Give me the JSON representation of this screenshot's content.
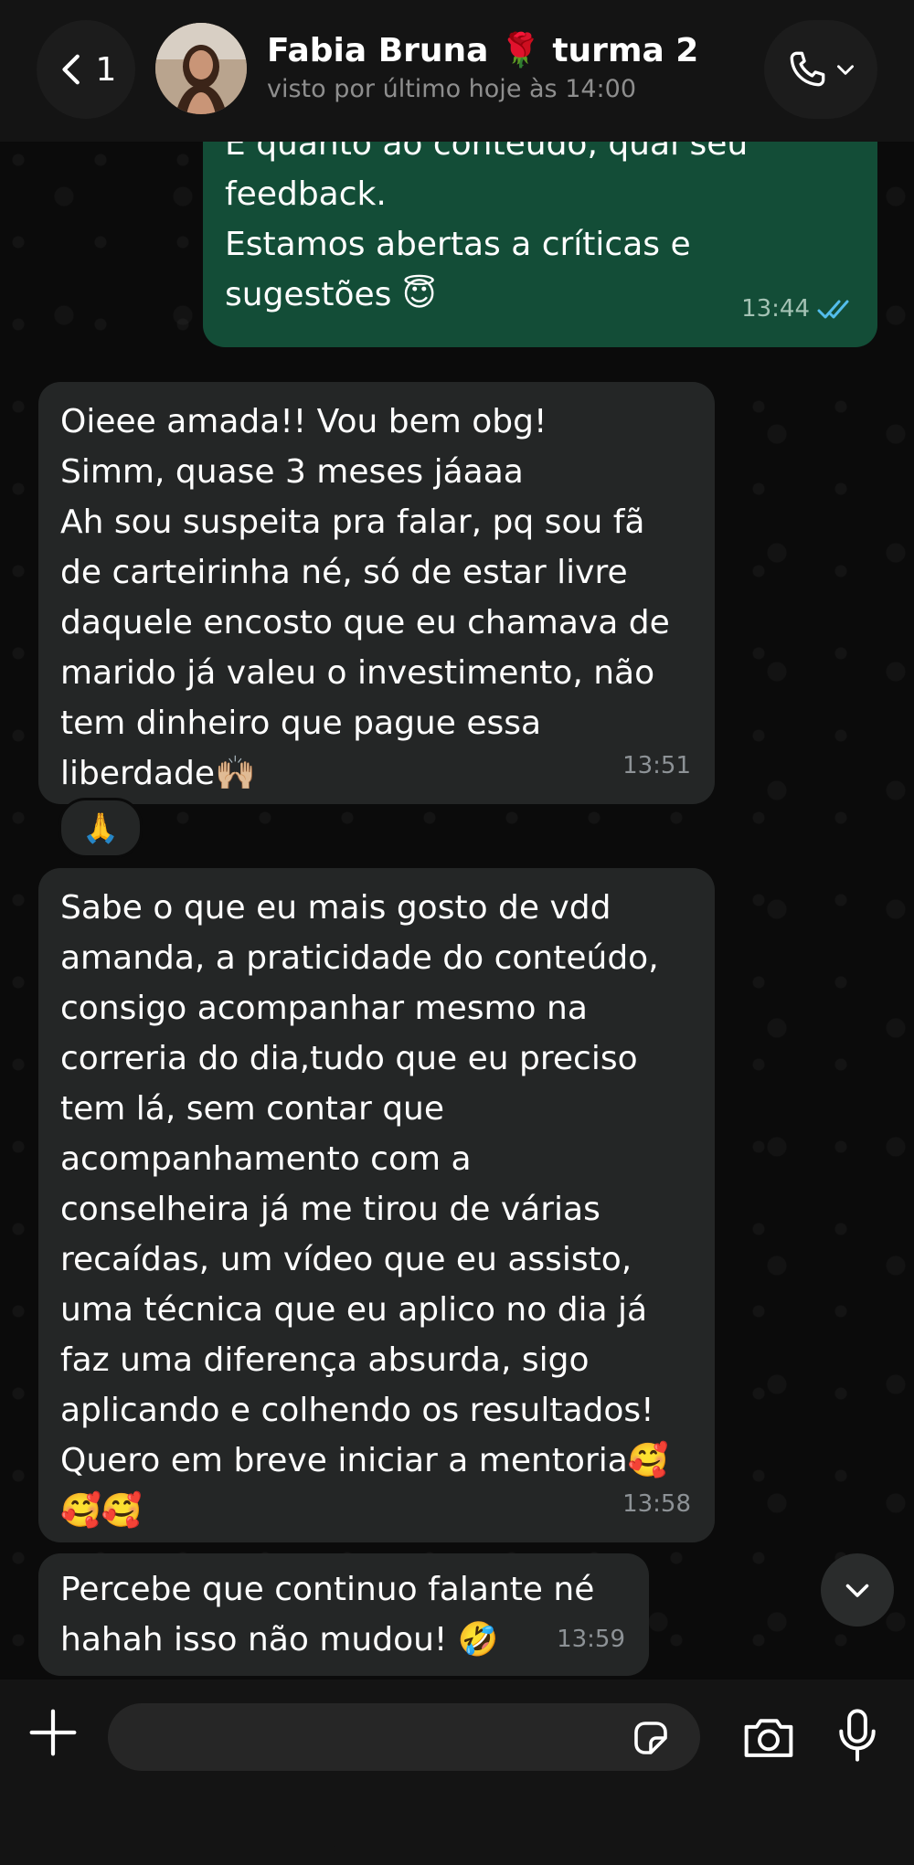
{
  "header": {
    "back_count": "1",
    "contact_name": "Fabia Bruna 🌹 turma 2",
    "contact_status": "visto por último hoje às 14:00"
  },
  "messages": [
    {
      "direction": "outgoing",
      "lines": [
        "E quanto ao conteúdo, qual seu",
        "feedback.",
        "Estamos abertas a críticas e",
        "sugestões 😇"
      ],
      "time": "13:44",
      "read": true
    },
    {
      "direction": "incoming",
      "lines": [
        "Oieee amada!! Vou bem obg!",
        "Simm, quase 3 meses jáaaa",
        "Ah sou suspeita pra falar, pq sou fã",
        "de carteirinha né, só de estar livre",
        "daquele encosto que eu chamava de",
        "marido já valeu o investimento, não",
        "tem dinheiro que pague essa",
        "liberdade🙌🏼"
      ],
      "time": "13:51",
      "reaction": "🙏"
    },
    {
      "direction": "incoming",
      "lines": [
        "Sabe o que eu mais gosto de vdd",
        "amanda, a praticidade do conteúdo,",
        "consigo acompanhar mesmo na",
        "correria do dia,tudo que eu preciso",
        "tem lá, sem contar que",
        "acompanhamento com a",
        "conselheira já me tirou de várias",
        "recaídas, um vídeo que eu assisto,",
        "uma técnica que eu aplico no dia já",
        "faz uma diferença absurda, sigo",
        "aplicando e colhendo os resultados!",
        "Quero em breve iniciar a mentoria🥰",
        "🥰🥰"
      ],
      "time": "13:58"
    },
    {
      "direction": "incoming",
      "lines": [
        "Percebe que continuo falante né",
        "hahah isso não mudou! 🤣"
      ],
      "time": "13:59"
    }
  ],
  "input": {
    "value": "",
    "placeholder": ""
  },
  "colors": {
    "outgoing_bubble": "#134d37",
    "incoming_bubble": "#242626",
    "read_ticks": "#53bdeb",
    "background": "#0b0b0b"
  },
  "icons": [
    "chevron-left-icon",
    "phone-icon",
    "chevron-down-icon",
    "plus-icon",
    "sticker-icon",
    "camera-icon",
    "mic-icon",
    "double-check-icon"
  ]
}
